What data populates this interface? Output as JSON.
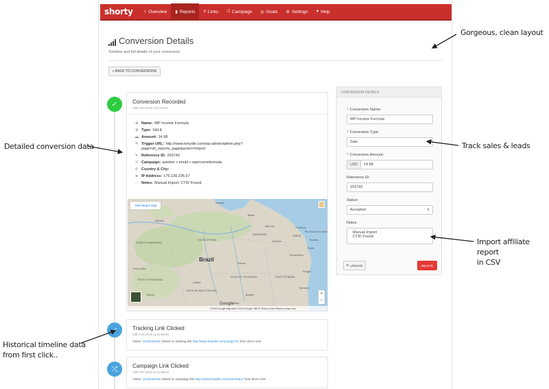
{
  "nav": {
    "brand": "shorty",
    "items": [
      {
        "label": "Overview",
        "icon": "home-icon",
        "glyph": "⌂",
        "active": false
      },
      {
        "label": "Reports",
        "icon": "bar-chart-icon",
        "glyph": "▮",
        "active": true
      },
      {
        "label": "Links",
        "icon": "list-icon",
        "glyph": "≡",
        "active": false
      },
      {
        "label": "Campaign",
        "icon": "shuffle-icon",
        "glyph": "⤮",
        "active": false
      },
      {
        "label": "Goals",
        "icon": "target-icon",
        "glyph": "◎",
        "active": false
      },
      {
        "label": "Settings",
        "icon": "gear-icon",
        "glyph": "⚙",
        "active": false
      },
      {
        "label": "Help",
        "icon": "heart-icon",
        "glyph": "♥",
        "active": false
      }
    ]
  },
  "header": {
    "title": "Conversion Details",
    "subtitle": "Timeline and full details of your conversion."
  },
  "back_button": "« BACK TO CONVERSIONS",
  "conversion": {
    "title": "Conversion Recorded",
    "date": "19th Feb 2016 at 9:22AM",
    "details": [
      {
        "icon": "info-icon",
        "glyph": "⚙",
        "label": "Name:",
        "value": "WP Income Formula"
      },
      {
        "icon": "tag-icon",
        "glyph": "⚙",
        "label": "Type:",
        "value": "SALE"
      },
      {
        "icon": "money-icon",
        "glyph": "▬",
        "label": "Amount:",
        "value": "14.98"
      },
      {
        "icon": "link-icon",
        "glyph": "✎",
        "label": "Trigger URL:",
        "value": "http://www.kreydle.com/wp-admin/admin.php?page=sh_reports_page&action=import"
      },
      {
        "icon": "paperclip-icon",
        "glyph": "✎",
        "label": "Reference ID:",
        "value": "203743"
      },
      {
        "icon": "shuffle-icon",
        "glyph": "⤮",
        "label": "Campaign:",
        "value": "aweber > email > wpincomeformula"
      },
      {
        "icon": "map-marker-icon",
        "glyph": "⚲",
        "label": "Country & City:",
        "value": ""
      },
      {
        "icon": "location-arrow-icon",
        "glyph": "➤",
        "label": "IP Address:",
        "value": "175.139.235.67"
      },
      {
        "icon": "comment-icon",
        "glyph": "◌",
        "label": "Notes:",
        "value": "Manual Import, CTID Found,"
      }
    ],
    "map": {
      "link": "View larger map",
      "country": "Brazil",
      "footer": "©2016 Google   Map data ©2016 Google, INEGI   Terms of Use   Report a map error",
      "google": "Google",
      "places": [
        {
          "name": "Macapá",
          "cls": "p1"
        },
        {
          "name": "Manaus",
          "cls": "p2"
        },
        {
          "name": "Belém",
          "cls": "p3"
        },
        {
          "name": "STATE OF AMAZONAS",
          "cls": "p4"
        },
        {
          "name": "STATE OF PARÁ",
          "cls": "p5"
        },
        {
          "name": "MARANHÃO",
          "cls": "p6"
        },
        {
          "name": "CEARÁ",
          "cls": "p7"
        },
        {
          "name": "Recife",
          "cls": "p8"
        },
        {
          "name": "Pernambuco",
          "cls": "p9"
        },
        {
          "name": "Brasília",
          "cls": "p10"
        },
        {
          "name": "STATE OF BAHIA",
          "cls": "p11"
        },
        {
          "name": "STATE OF RONDÔNIA",
          "cls": "p12"
        },
        {
          "name": "STATE OF MATO GROSSO",
          "cls": "p13"
        },
        {
          "name": "STATE OF TOCANTINS",
          "cls": "p14"
        },
        {
          "name": "Salvador",
          "cls": "p15"
        },
        {
          "name": "Bolivia",
          "cls": "p16"
        },
        {
          "name": "Porto Velho",
          "cls": "p17"
        },
        {
          "name": "Fortaleza",
          "cls": "p18"
        },
        {
          "name": "Paraíba",
          "cls": "p19"
        },
        {
          "name": "Rio Grande do Norte",
          "cls": "p20"
        },
        {
          "name": "Sergipe",
          "cls": "p21"
        },
        {
          "name": "Teresina",
          "cls": "p22"
        },
        {
          "name": "Palmas",
          "cls": "p23"
        },
        {
          "name": "Goiânia",
          "cls": "p24"
        },
        {
          "name": "Cuiabá",
          "cls": "p25"
        },
        {
          "name": "São Luís",
          "cls": "p26"
        }
      ]
    }
  },
  "tracking": {
    "title": "Tracking Link Clicked",
    "date": "19th Feb 2016 at 11:59AM",
    "visitor": "-2133030434",
    "pre": "Visitor ",
    "mid": " clicked on tracking link ",
    "link": "http://www.kreydle.com/u/s/gy7Ox",
    "post": " from direct visit"
  },
  "campaign": {
    "title": "Campaign Link Clicked",
    "date": "19th Feb 2016 at 11:59AM",
    "visitor": "-2133030434",
    "pre": "Visitor ",
    "mid": " clicked on campaign link ",
    "link": "http://www.kreydle.com/u/c/el40pu7",
    "post": " from direct visit"
  },
  "panel": {
    "title": "CONVERSION DETAILS",
    "name_label": "Conversion Name:",
    "name_value": "WP Income Formula",
    "type_label": "Conversion Type:",
    "type_value": "Sale",
    "amount_label": "Conversion Amount:",
    "currency": "USD",
    "amount_value": "14.98",
    "ref_label": "Reference ID:",
    "ref_value": "203743",
    "status_label": "Status:",
    "status_value": "Accepted",
    "notes_label": "Notes:",
    "notes_line1": "Manual Import",
    "notes_line2": "CTID Found",
    "update": "UPDATE",
    "delete": "DELETE"
  },
  "annotations": {
    "layout": "Gorgeous, clean layout",
    "detailed": "Detailed conversion data",
    "track": "Track sales & leads",
    "import1": "Import affiliate report",
    "import2": "in CSV",
    "hist1": "Historical timeline data",
    "hist2": "from first click.."
  },
  "colors": {
    "navbar": "#c9302c",
    "success": "#2ecc40",
    "info": "#4aa3df",
    "danger": "#e53935",
    "link": "#2a8ad6"
  }
}
